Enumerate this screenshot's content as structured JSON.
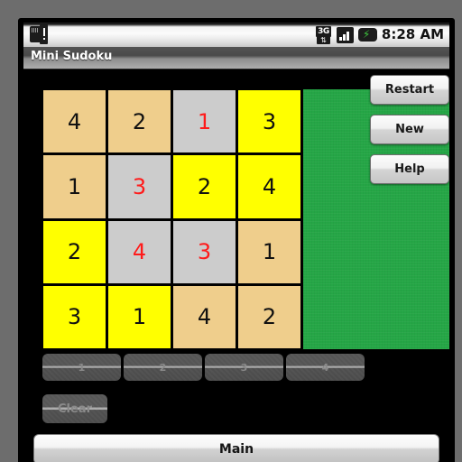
{
  "statusbar": {
    "icons_left": [
      "sdcard-warning-icon"
    ],
    "icons_right": [
      "3g-data-icon",
      "signal-bars-icon",
      "battery-charging-icon"
    ],
    "network_label": "3G",
    "network_arrows": "⇅",
    "time": "8:28 AM"
  },
  "titlebar": {
    "title": "Mini Sudoku"
  },
  "colors": {
    "given_cell": "#EFCE8C",
    "highlight_cell": "#FFFF00",
    "selected_cell": "#CCCCCC",
    "panel_green": "#25A646",
    "entered_number": "#FF1A1A",
    "given_number": "#111111"
  },
  "board": {
    "size": 4,
    "cells": [
      {
        "value": "4",
        "fill": "tan",
        "entered": false
      },
      {
        "value": "2",
        "fill": "tan",
        "entered": false
      },
      {
        "value": "1",
        "fill": "gry",
        "entered": true
      },
      {
        "value": "3",
        "fill": "yel",
        "entered": false
      },
      {
        "value": "1",
        "fill": "tan",
        "entered": false
      },
      {
        "value": "3",
        "fill": "gry",
        "entered": true
      },
      {
        "value": "2",
        "fill": "yel",
        "entered": false
      },
      {
        "value": "4",
        "fill": "yel",
        "entered": false
      },
      {
        "value": "2",
        "fill": "yel",
        "entered": false
      },
      {
        "value": "4",
        "fill": "gry",
        "entered": true
      },
      {
        "value": "3",
        "fill": "gry",
        "entered": true
      },
      {
        "value": "1",
        "fill": "tan",
        "entered": false
      },
      {
        "value": "3",
        "fill": "yel",
        "entered": false
      },
      {
        "value": "1",
        "fill": "yel",
        "entered": false
      },
      {
        "value": "4",
        "fill": "tan",
        "entered": false
      },
      {
        "value": "2",
        "fill": "tan",
        "entered": false
      }
    ]
  },
  "actions": {
    "restart": "Restart",
    "new": "New",
    "help": "Help"
  },
  "numberpad": {
    "buttons": [
      "1",
      "2",
      "3",
      "4"
    ],
    "clear": "Clear",
    "enabled": false
  },
  "footer": {
    "main": "Main"
  }
}
